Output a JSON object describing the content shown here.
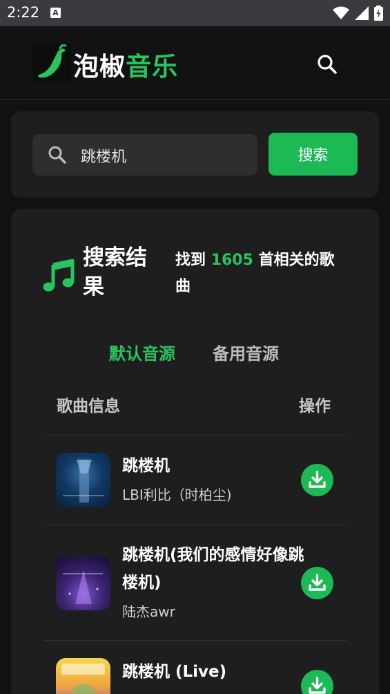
{
  "status_bar": {
    "time": "2:22",
    "notification_letter": "A"
  },
  "header": {
    "brand_white": "泡椒",
    "brand_green": "音乐",
    "logo_icon": "chili-pepper-icon",
    "search_icon": "search-icon"
  },
  "search": {
    "value": "跳楼机",
    "button_label": "搜索"
  },
  "results": {
    "title": "搜索结果",
    "summary_prefix": "找到",
    "count": "1605",
    "summary_suffix": "首相关的歌曲",
    "source_tabs": [
      {
        "label": "默认音源",
        "active": true
      },
      {
        "label": "备用音源",
        "active": false
      }
    ],
    "columns": {
      "song_info": "歌曲信息",
      "actions": "操作"
    },
    "songs": [
      {
        "title": "跳楼机",
        "artist": "LBI利比（时柏尘)"
      },
      {
        "title": "跳楼机(我们的感情好像跳楼机)",
        "artist": "陆杰awr"
      },
      {
        "title": "跳楼机 (Live)",
        "artist": ""
      }
    ]
  },
  "colors": {
    "accent": "#1db954",
    "accent_text": "#2ac45e",
    "background": "#111111",
    "card": "#1e1e1e"
  }
}
